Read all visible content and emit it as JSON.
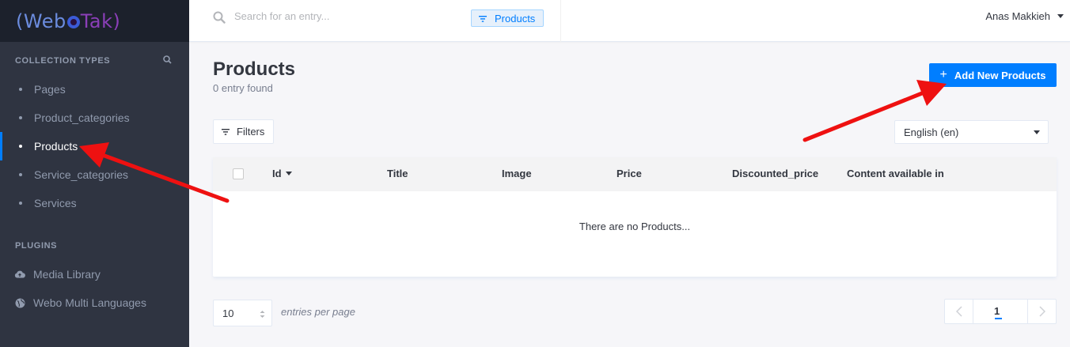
{
  "app": {
    "logo_text": "(WeboTak)"
  },
  "sidebar": {
    "collection_title": "COLLECTION TYPES",
    "collection_items": [
      {
        "label": "Pages",
        "active": false
      },
      {
        "label": "Product_categories",
        "active": false
      },
      {
        "label": "Products",
        "active": true
      },
      {
        "label": "Service_categories",
        "active": false
      },
      {
        "label": "Services",
        "active": false
      }
    ],
    "plugins_title": "PLUGINS",
    "plugin_items": [
      {
        "label": "Media Library",
        "icon": "cloud-upload-icon"
      },
      {
        "label": "Webo Multi Languages",
        "icon": "globe-icon"
      }
    ]
  },
  "header": {
    "search_placeholder": "Search for an entry...",
    "filter_tag": "Products",
    "user_name": "Anas Makkieh"
  },
  "main": {
    "title": "Products",
    "entry_count": "0 entry found",
    "add_button": "Add New Products",
    "filters_button": "Filters",
    "locale": "English (en)"
  },
  "table": {
    "columns": [
      "Id",
      "Title",
      "Image",
      "Price",
      "Discounted_price",
      "Content available in"
    ],
    "empty_message": "There are no Products..."
  },
  "pagination": {
    "per_page": "10",
    "per_page_label": "entries per page",
    "current_page": "1"
  },
  "colors": {
    "accent": "#007eff",
    "sidebar_bg": "#2f3441",
    "annotation_arrow": "#ee1111"
  }
}
